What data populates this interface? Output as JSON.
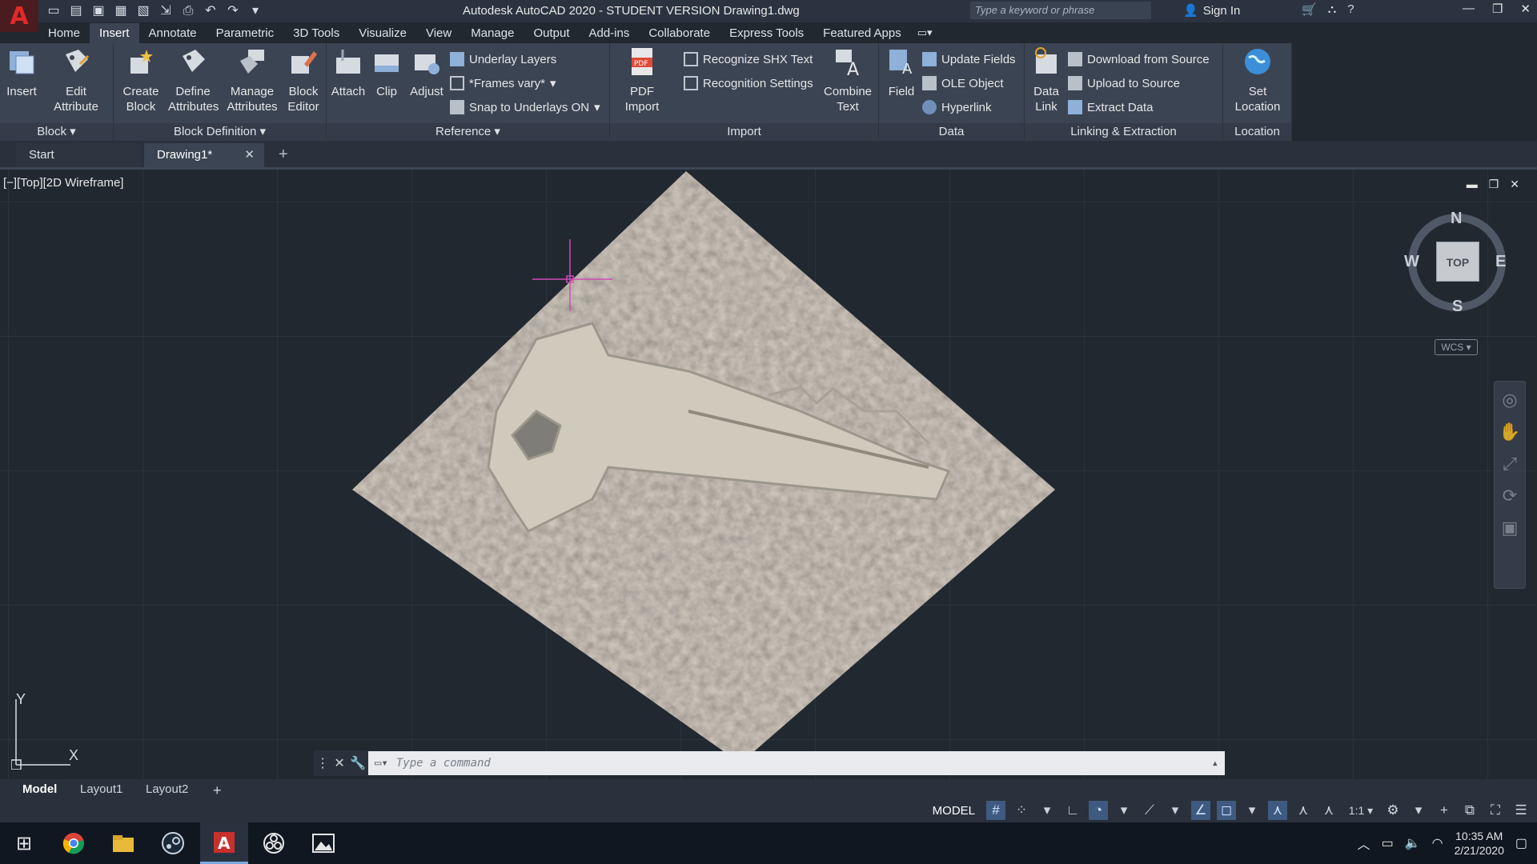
{
  "titlebar": {
    "logo": "A",
    "title": "Autodesk AutoCAD 2020 - STUDENT VERSION    Drawing1.dwg",
    "search_placeholder": "Type a keyword or phrase",
    "signin": "Sign In"
  },
  "ribbon_tabs": [
    "Home",
    "Insert",
    "Annotate",
    "Parametric",
    "3D Tools",
    "Visualize",
    "View",
    "Manage",
    "Output",
    "Add-ins",
    "Collaborate",
    "Express Tools",
    "Featured Apps"
  ],
  "ribbon": {
    "block": {
      "footer": "Block ▾",
      "insert": "Insert",
      "edit_attribute": "Edit Attribute"
    },
    "block_definition": {
      "footer": "Block Definition ▾",
      "create_block": "Create Block",
      "define_attributes": "Define Attributes",
      "manage_attributes": "Manage Attributes",
      "block_editor": "Block Editor"
    },
    "reference": {
      "footer": "Reference ▾",
      "attach": "Attach",
      "clip": "Clip",
      "adjust": "Adjust",
      "underlay_layers": "Underlay Layers",
      "frames_vary": "*Frames vary*",
      "snap_underlays": "Snap to Underlays ON"
    },
    "import": {
      "footer": "Import",
      "pdf_import": "PDF Import",
      "recognize_shx": "Recognize SHX Text",
      "recognition_settings": "Recognition Settings",
      "combine_text": "Combine Text"
    },
    "data": {
      "footer": "Data",
      "field": "Field",
      "update_fields": "Update Fields",
      "ole_object": "OLE Object",
      "hyperlink": "Hyperlink"
    },
    "linking": {
      "footer": "Linking & Extraction",
      "data_link": "Data Link",
      "download_source": "Download from Source",
      "upload_source": "Upload to Source",
      "extract_data": "Extract  Data"
    },
    "location": {
      "footer": "Location",
      "set_location": "Set Location"
    }
  },
  "doctabs": {
    "start": "Start",
    "drawing": "Drawing1*"
  },
  "viewport": {
    "label": "[−][Top][2D Wireframe]",
    "compass": {
      "n": "N",
      "s": "S",
      "e": "E",
      "w": "W",
      "top": "TOP"
    },
    "wcs": "WCS ▾",
    "ucs_x": "X",
    "ucs_y": "Y"
  },
  "command": {
    "placeholder": "Type a command"
  },
  "layout_tabs": [
    "Model",
    "Layout1",
    "Layout2"
  ],
  "status": {
    "model": "MODEL",
    "scale": "1:1 ▾"
  },
  "taskbar": {
    "time": "10:35 AM",
    "date": "2/21/2020"
  },
  "colors": {
    "accent": "#3e5a80",
    "ribbon_bg": "#3b4453",
    "canvas_bg": "#212830",
    "crosshair": "#d04ab8"
  }
}
